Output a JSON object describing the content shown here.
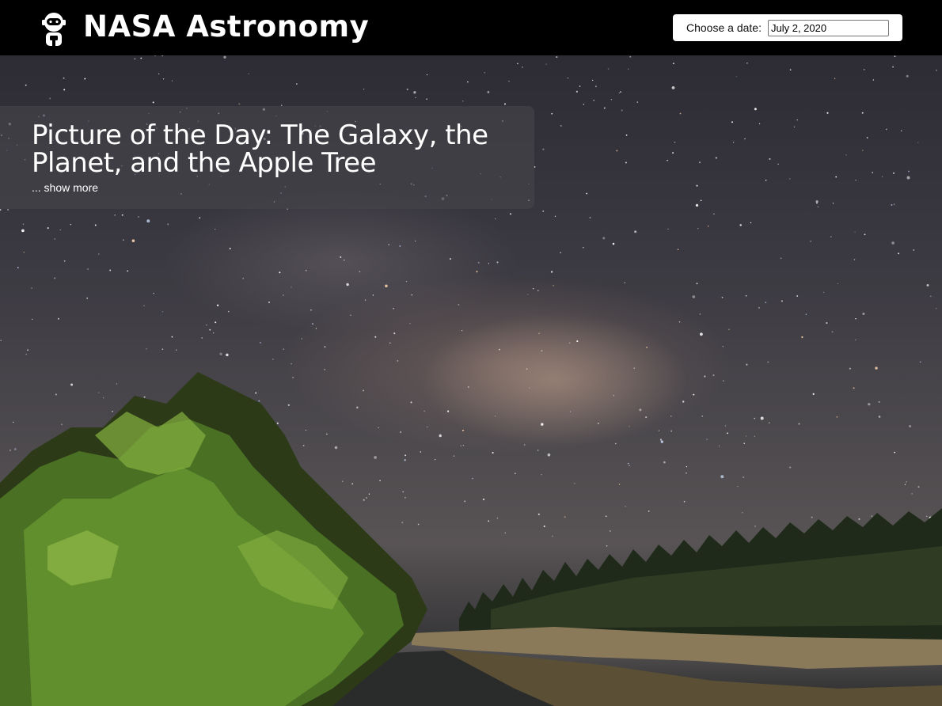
{
  "header": {
    "logo_icon": "astronaut-icon",
    "title": "NASA Astronomy"
  },
  "date_picker": {
    "label": "Choose a date:",
    "value": "July 2, 2020"
  },
  "apod": {
    "title": "Picture of the Day: The Galaxy, the Planet, and the Apple Tree",
    "show_more": "... show more"
  },
  "colors": {
    "header_bg": "#000000",
    "panel_bg": "rgba(70,70,74,0.62)",
    "text": "#ffffff"
  }
}
